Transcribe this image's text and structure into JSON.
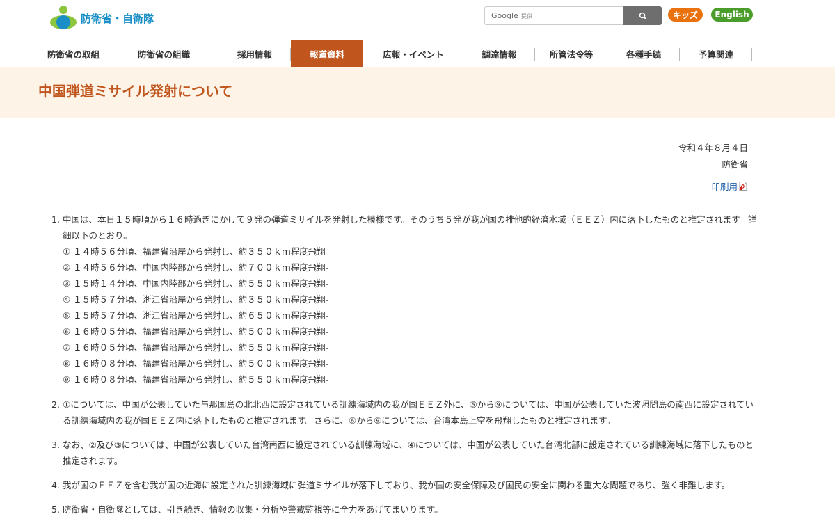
{
  "header": {
    "logo_text": "防衛省・自衛隊",
    "search": {
      "brand": "Google",
      "provided": "提供",
      "placeholder": ""
    },
    "kids_label": "キッズ",
    "english_label": "English",
    "colors": {
      "brand_blue": "#1a8fc7",
      "accent": "#c0561d",
      "kids": "#e9720f",
      "english": "#4a9d2a"
    }
  },
  "nav": {
    "items": [
      {
        "label": "防衛省の取組"
      },
      {
        "label": "防衛省の組織"
      },
      {
        "label": "採用情報"
      },
      {
        "label": "報道資料"
      },
      {
        "label": "広報・イベント"
      },
      {
        "label": "調達情報"
      },
      {
        "label": "所管法令等"
      },
      {
        "label": "各種手続"
      },
      {
        "label": "予算関連"
      }
    ],
    "active_index": 3
  },
  "page": {
    "title": "中国弾道ミサイル発射について",
    "date": "令和４年８月４日",
    "org": "防衛省",
    "print_label": "印刷用"
  },
  "content": {
    "items": [
      {
        "num": "1.",
        "text": "中国は、本日１５時頃から１６時過ぎにかけて９発の弾道ミサイルを発射した模様です。そのうち５発が我が国の排他的経済水域（ＥＥＺ）内に落下したものと推定されます。詳細以下のとおり。",
        "subs": [
          "① １４時５６分頃、福建省沿岸から発射し、約３５０ｋｍ程度飛翔。",
          "② １４時５６分頃、中国内陸部から発射し、約７００ｋｍ程度飛翔。",
          "③ １５時１４分頃、中国内陸部から発射し、約５５０ｋｍ程度飛翔。",
          "④ １５時５７分頃、浙江省沿岸から発射し、約３５０ｋｍ程度飛翔。",
          "⑤ １５時５７分頃、浙江省沿岸から発射し、約６５０ｋｍ程度飛翔。",
          "⑥ １６時０５分頃、福建省沿岸から発射し、約５００ｋｍ程度飛翔。",
          "⑦ １６時０５分頃、福建省沿岸から発射し、約５５０ｋｍ程度飛翔。",
          "⑧ １６時０８分頃、福建省沿岸から発射し、約５００ｋｍ程度飛翔。",
          "⑨ １６時０８分頃、福建省沿岸から発射し、約５５０ｋｍ程度飛翔。"
        ]
      },
      {
        "num": "2.",
        "text": "①については、中国が公表していた与那国島の北北西に設定されている訓練海域内の我が国ＥＥＺ外に、⑤から⑨については、中国が公表していた波照間島の南西に設定されている訓練海域内の我が国ＥＥＺ内に落下したものと推定されます。さらに、⑥から⑨については、台湾本島上空を飛翔したものと推定されます。"
      },
      {
        "num": "3.",
        "text": "なお、②及び③については、中国が公表していた台湾南西に設定されている訓練海域に、④については、中国が公表していた台湾北部に設定されている訓練海域に落下したものと推定されます。"
      },
      {
        "num": "4.",
        "text": "我が国のＥＥＺを含む我が国の近海に設定された訓練海域に弾道ミサイルが落下しており、我が国の安全保障及び国民の安全に関わる重大な問題であり、強く非難します。"
      },
      {
        "num": "5.",
        "text": "防衛省・自衛隊としては、引き続き、情報の収集・分析や警戒監視等に全力をあげてまいります。"
      }
    ]
  }
}
